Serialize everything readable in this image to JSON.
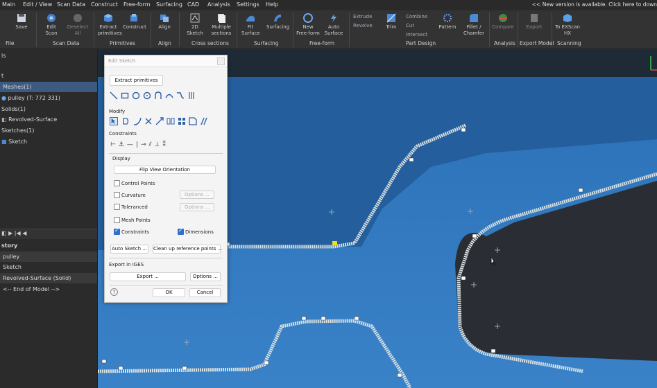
{
  "menu": [
    "Main",
    "Edit / View",
    "Scan Data",
    "Construct",
    "Free-form",
    "Surfacing",
    "CAD",
    "Analysis",
    "Settings",
    "Help"
  ],
  "notice": "<< New version is available. Click here to down",
  "ribbon": {
    "buttons": [
      {
        "label": "Save"
      },
      {
        "label": "Edit\nScan"
      },
      {
        "label": "Deselect\nAll"
      },
      {
        "label": "Extract\nprimitives"
      },
      {
        "label": "Construct"
      },
      {
        "label": "Align"
      },
      {
        "label": "2D\nSketch"
      },
      {
        "label": "Multiple\nsections"
      },
      {
        "label": "Fit\nSurface"
      },
      {
        "label": "Surfacing"
      },
      {
        "label": "New\nFree-form"
      },
      {
        "label": "Auto\nSurface"
      },
      {
        "label": "Trim"
      },
      {
        "label": "Pattern"
      },
      {
        "label": "Fillet /\nChamfer"
      },
      {
        "label": "Compare"
      },
      {
        "label": "Export"
      },
      {
        "label": "To EXScan\nHX"
      }
    ],
    "small": [
      "Extrude",
      "Revolve",
      "Combine",
      "Cut",
      "Intersect"
    ],
    "groups": [
      "File",
      "Scan Data",
      "Primitives",
      "Align",
      "Cross sections",
      "Surfacing",
      "Free-form",
      "Part Design",
      "Analysis",
      "Export Model",
      "Scanning"
    ]
  },
  "tree": {
    "items": [
      "t",
      "Meshes(1)",
      "pulley (T: 772 331)",
      "Solids(1)",
      "Revolved-Surface",
      "Sketches(1)",
      "Sketch"
    ]
  },
  "history": {
    "items": [
      "story",
      "pulley",
      "Sketch",
      "Revolved-Surface (Solid)",
      "<-- End of Model -->"
    ]
  },
  "dialog": {
    "title": "Edit Sketch",
    "extract": "Extract primitives",
    "modify": "Modify",
    "constraints": "Constraints",
    "display": "Display",
    "flip": "Flip View Orientation",
    "control_points": "Control Points",
    "curvature": "Curvature",
    "toleranced": "Toleranced",
    "mesh_points": "Mesh Points",
    "constraints_cb": "Constraints",
    "dimensions_cb": "Dimensions",
    "options": "Options ...",
    "auto_sketch": "Auto Sketch ...",
    "cleanup": "Clean up reference points ...",
    "export_iges": "Export in IGES",
    "export": "Export ...",
    "options2": "Options ...",
    "ok": "OK",
    "cancel": "Cancel",
    "help": "?",
    "checked": {
      "control_points": false,
      "curvature": false,
      "toleranced": false,
      "mesh_points": false,
      "constraints": true,
      "dimensions": true
    }
  },
  "colors": {
    "viewport": "#2e6fb0",
    "accent": "#2f6fcf",
    "selection": "#3d5a80"
  }
}
